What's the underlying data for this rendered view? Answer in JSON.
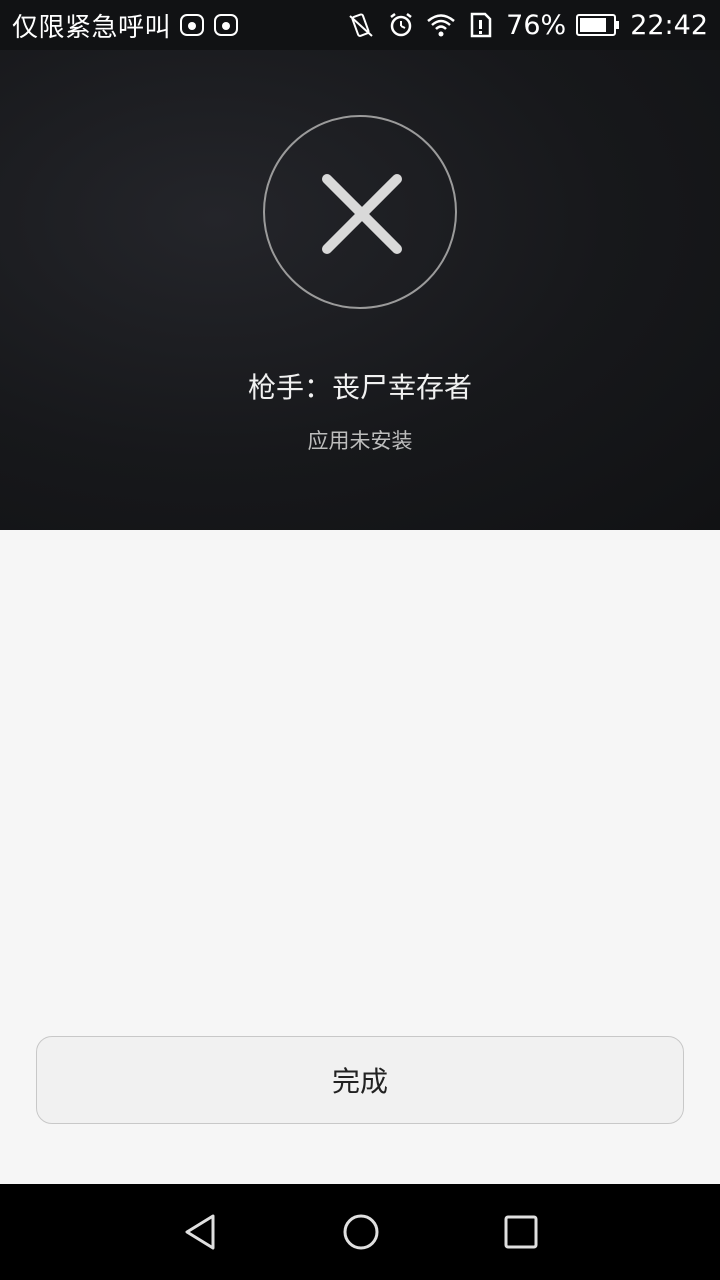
{
  "status_bar": {
    "carrier": "仅限紧急呼叫",
    "notification_icons": [
      "huawei-app-icon",
      "huawei-app-icon"
    ],
    "system_icons": [
      "vibrate-icon",
      "alarm-icon",
      "wifi-icon",
      "sim-icon"
    ],
    "battery_percent": "76%",
    "time": "22:42"
  },
  "header": {
    "result_icon": "close-x-icon",
    "app_name": "枪手：丧尸幸存者",
    "status": "应用未安装"
  },
  "footer": {
    "done_label": "完成"
  },
  "nav_bar": {
    "buttons": [
      "back-icon",
      "home-icon",
      "recent-apps-icon"
    ]
  },
  "colors": {
    "header_bg": "#17181b",
    "content_bg": "#f6f6f6",
    "button_bg": "#f1f1f1",
    "nav_bg": "#000000"
  }
}
